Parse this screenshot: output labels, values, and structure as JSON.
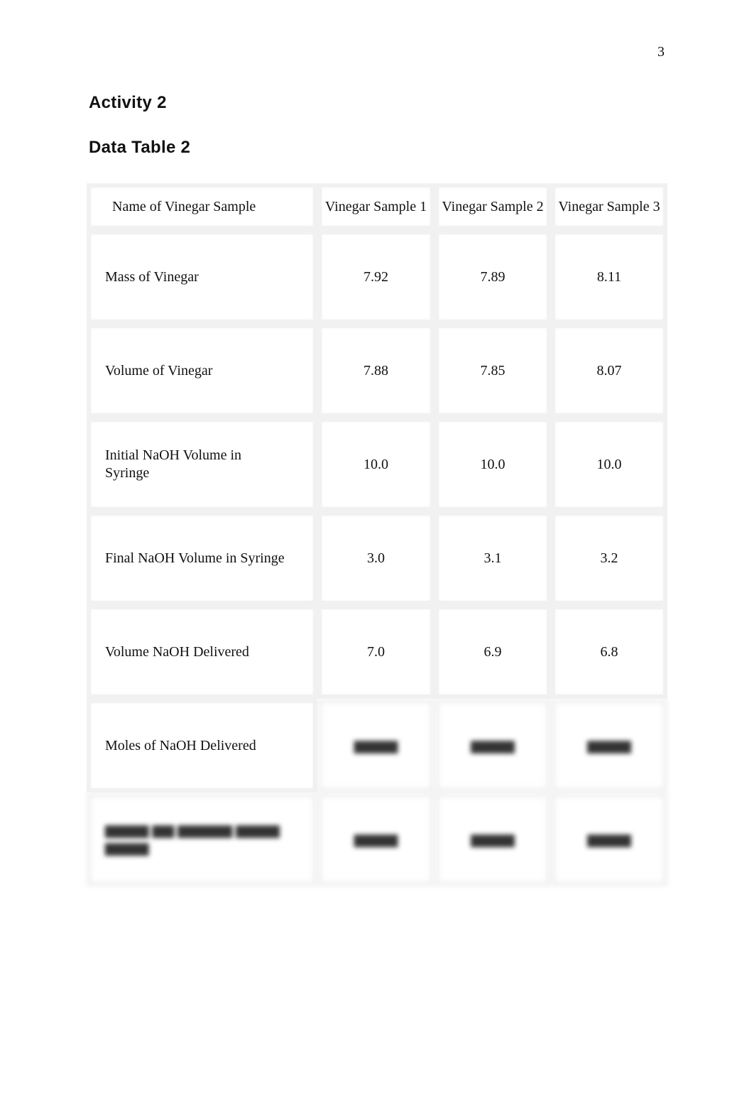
{
  "page_number": "3",
  "headings": {
    "activity": "Activity 2",
    "table_title": "Data Table 2"
  },
  "table": {
    "header": [
      "Name of Vinegar Sample",
      "Vinegar Sample 1",
      "Vinegar Sample 2",
      "Vinegar Sample 3"
    ],
    "rows": [
      {
        "label": "Mass of Vinegar",
        "values": [
          "7.92",
          "7.89",
          "8.11"
        ]
      },
      {
        "label": "Volume of Vinegar",
        "values": [
          "7.88",
          "7.85",
          "8.07"
        ]
      },
      {
        "label": "Initial NaOH Volume in Syringe",
        "values": [
          "10.0",
          "10.0",
          "10.0"
        ]
      },
      {
        "label": "Final NaOH Volume in Syringe",
        "values": [
          "3.0",
          "3.1",
          "3.2"
        ]
      },
      {
        "label": "Volume NaOH Delivered",
        "values": [
          "7.0",
          "6.9",
          "6.8"
        ]
      },
      {
        "label": "Moles of NaOH Delivered",
        "values": [
          "▆▆▆▆",
          "▆▆▆▆",
          "▆▆▆▆"
        ],
        "values_blurred": true
      },
      {
        "label": "▆▆▆▆ ▆▆ ▆▆▆▆▆ ▆▆▆▆ ▆▆▆▆",
        "label_blurred": true,
        "values": [
          "▆▆▆▆",
          "▆▆▆▆",
          "▆▆▆▆"
        ],
        "values_blurred": true
      }
    ]
  }
}
